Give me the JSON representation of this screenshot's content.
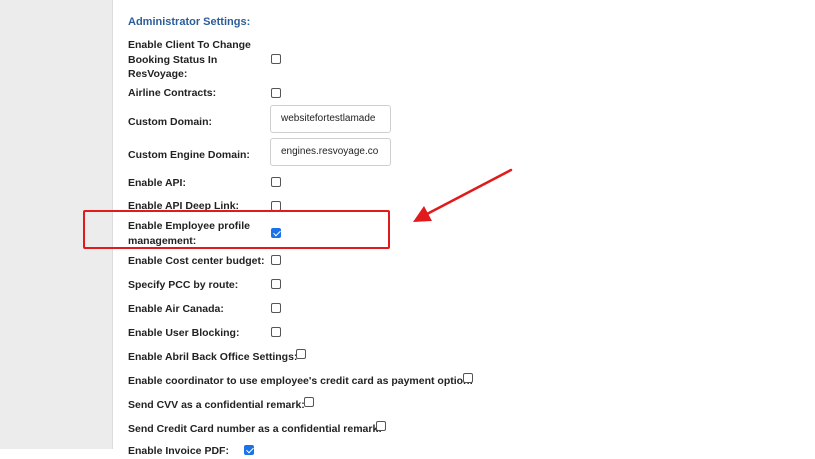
{
  "section": {
    "title": "Administrator Settings:"
  },
  "settings": [
    {
      "label": "Enable Client To Change Booking Status In ResVoyage:",
      "checked": false
    },
    {
      "label": "Airline Contracts:",
      "checked": false
    },
    {
      "label": "Custom Domain:",
      "value": "websitefortestlamade"
    },
    {
      "label": "Custom Engine Domain:",
      "value": "engines.resvoyage.co"
    },
    {
      "label": "Enable API:",
      "checked": false
    },
    {
      "label": "Enable API Deep Link:",
      "checked": false
    },
    {
      "label": "Enable Employee profile management:",
      "checked": true
    },
    {
      "label": "Enable Cost center budget:",
      "checked": false
    },
    {
      "label": "Specify PCC by route:",
      "checked": false
    },
    {
      "label": "Enable Air Canada:",
      "checked": false
    },
    {
      "label": "Enable User Blocking:",
      "checked": false
    },
    {
      "label": "Enable Abril Back Office Settings:",
      "checked": false
    },
    {
      "label": "Enable coordinator to use employee's credit card as payment option:",
      "checked": false
    },
    {
      "label": "Send CVV as a confidential remark:",
      "checked": false
    },
    {
      "label": "Send Credit Card number as a confidential remark:",
      "checked": false
    },
    {
      "label": "Enable Invoice PDF:",
      "checked": true
    }
  ],
  "annotation": {
    "color": "#e11b1b"
  }
}
